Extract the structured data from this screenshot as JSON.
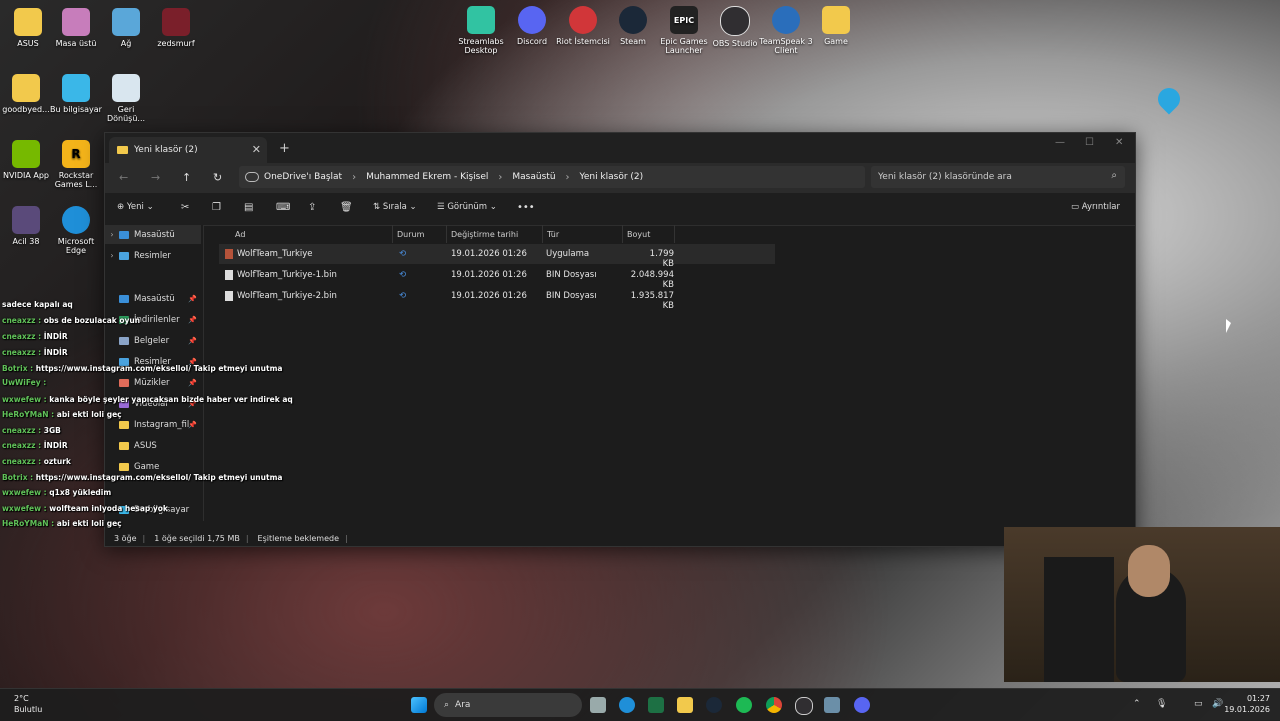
{
  "desktop": {
    "left_icons": [
      {
        "label": "ASUS"
      },
      {
        "label": "Masa üstü"
      },
      {
        "label": "Ağ"
      },
      {
        "label": "zedsmurf"
      },
      {
        "label": "goodbyed..."
      },
      {
        "label": "Bu bilgisayar"
      },
      {
        "label": "Geri Dönüşü..."
      },
      {
        "label": "NVIDIA App"
      },
      {
        "label": "Rockstar Games L..."
      },
      {
        "label": "Acil 38"
      },
      {
        "label": "Microsoft Edge"
      }
    ],
    "top_icons": [
      {
        "label": "Streamlabs Desktop"
      },
      {
        "label": "Discord"
      },
      {
        "label": "Riot İstemcisi"
      },
      {
        "label": "Steam"
      },
      {
        "label": "Epic Games Launcher"
      },
      {
        "label": "OBS Studio"
      },
      {
        "label": "TeamSpeak 3 Client"
      },
      {
        "label": "Game"
      }
    ]
  },
  "explorer": {
    "tab_title": "Yeni klasör (2)",
    "breadcrumbs": [
      "OneDrive'ı Başlat",
      "Muhammed Ekrem - Kişisel",
      "Masaüstü",
      "Yeni klasör (2)"
    ],
    "search_placeholder": "Yeni klasör (2) klasöründe ara",
    "toolbar": {
      "new": "Yeni",
      "sort": "Sırala",
      "view": "Görünüm",
      "details": "Ayrıntılar"
    },
    "sidebar": [
      {
        "label": "Masaüstü",
        "selected": true,
        "expandable": true
      },
      {
        "label": "Resimler",
        "expandable": true
      },
      {
        "label": "Masaüstü",
        "pinned": true
      },
      {
        "label": "İndirilenler",
        "pinned": true
      },
      {
        "label": "Belgeler",
        "pinned": true
      },
      {
        "label": "Resimler",
        "pinned": true
      },
      {
        "label": "Müzikler",
        "pinned": true
      },
      {
        "label": "Videolar",
        "pinned": true
      },
      {
        "label": "Instagram_fil",
        "pinned": true
      },
      {
        "label": "ASUS"
      },
      {
        "label": "Game"
      },
      {
        "label": "Bu bilgisayar"
      }
    ],
    "columns": [
      "Ad",
      "Durum",
      "Değiştirme tarihi",
      "Tür",
      "Boyut"
    ],
    "files": [
      {
        "name": "WolfTeam_Turkiye",
        "modified": "19.01.2026 01:26",
        "type": "Uygulama",
        "size": "1.799 KB",
        "selected": true
      },
      {
        "name": "WolfTeam_Turkiye-1.bin",
        "modified": "19.01.2026 01:26",
        "type": "BIN Dosyası",
        "size": "2.048.994 KB"
      },
      {
        "name": "WolfTeam_Turkiye-2.bin",
        "modified": "19.01.2026 01:26",
        "type": "BIN Dosyası",
        "size": "1.935.817 KB"
      }
    ],
    "status": {
      "count": "3 öğe",
      "selection": "1 öğe seçildi  1,75 MB",
      "sync": "Eşitleme beklemede"
    }
  },
  "chat": [
    {
      "user": "",
      "text": "sadece kapalı aq"
    },
    {
      "user": "cneaxzz :",
      "text": "obs de bozulacak oyun"
    },
    {
      "user": "cneaxzz :",
      "text": "İNDİR"
    },
    {
      "user": "cneaxzz :",
      "text": "İNDİR"
    },
    {
      "user": "Botrix :",
      "text": "https://www.instagram.com/eksellol/ Takip etmeyi unutma"
    },
    {
      "user": "UwWiFey :",
      "text": ""
    },
    {
      "user": "wxwefew :",
      "text": "kanka böyle şeyler yapıcaksan bizde haber ver indirek aq"
    },
    {
      "user": "HeRoYMaN :",
      "text": "abi ekti loli geç"
    },
    {
      "user": "cneaxzz :",
      "text": "3GB"
    },
    {
      "user": "cneaxzz :",
      "text": "İNDİR"
    },
    {
      "user": "cneaxzz :",
      "text": "ozturk"
    },
    {
      "user": "Botrix :",
      "text": "https://www.instagram.com/eksellol/ Takip etmeyi unutma"
    },
    {
      "user": "wxwefew :",
      "text": "q1x8 yükledim"
    },
    {
      "user": "wxwefew :",
      "text": "wolfteam inlyoda hesap yok"
    },
    {
      "user": "HeRoYMaN :",
      "text": "abi ekti loli geç"
    }
  ],
  "taskbar": {
    "search_placeholder": "Ara",
    "weather_temp": "2°C",
    "weather_desc": "Bulutlu",
    "time": "01:27",
    "date": "19.01.2026"
  }
}
